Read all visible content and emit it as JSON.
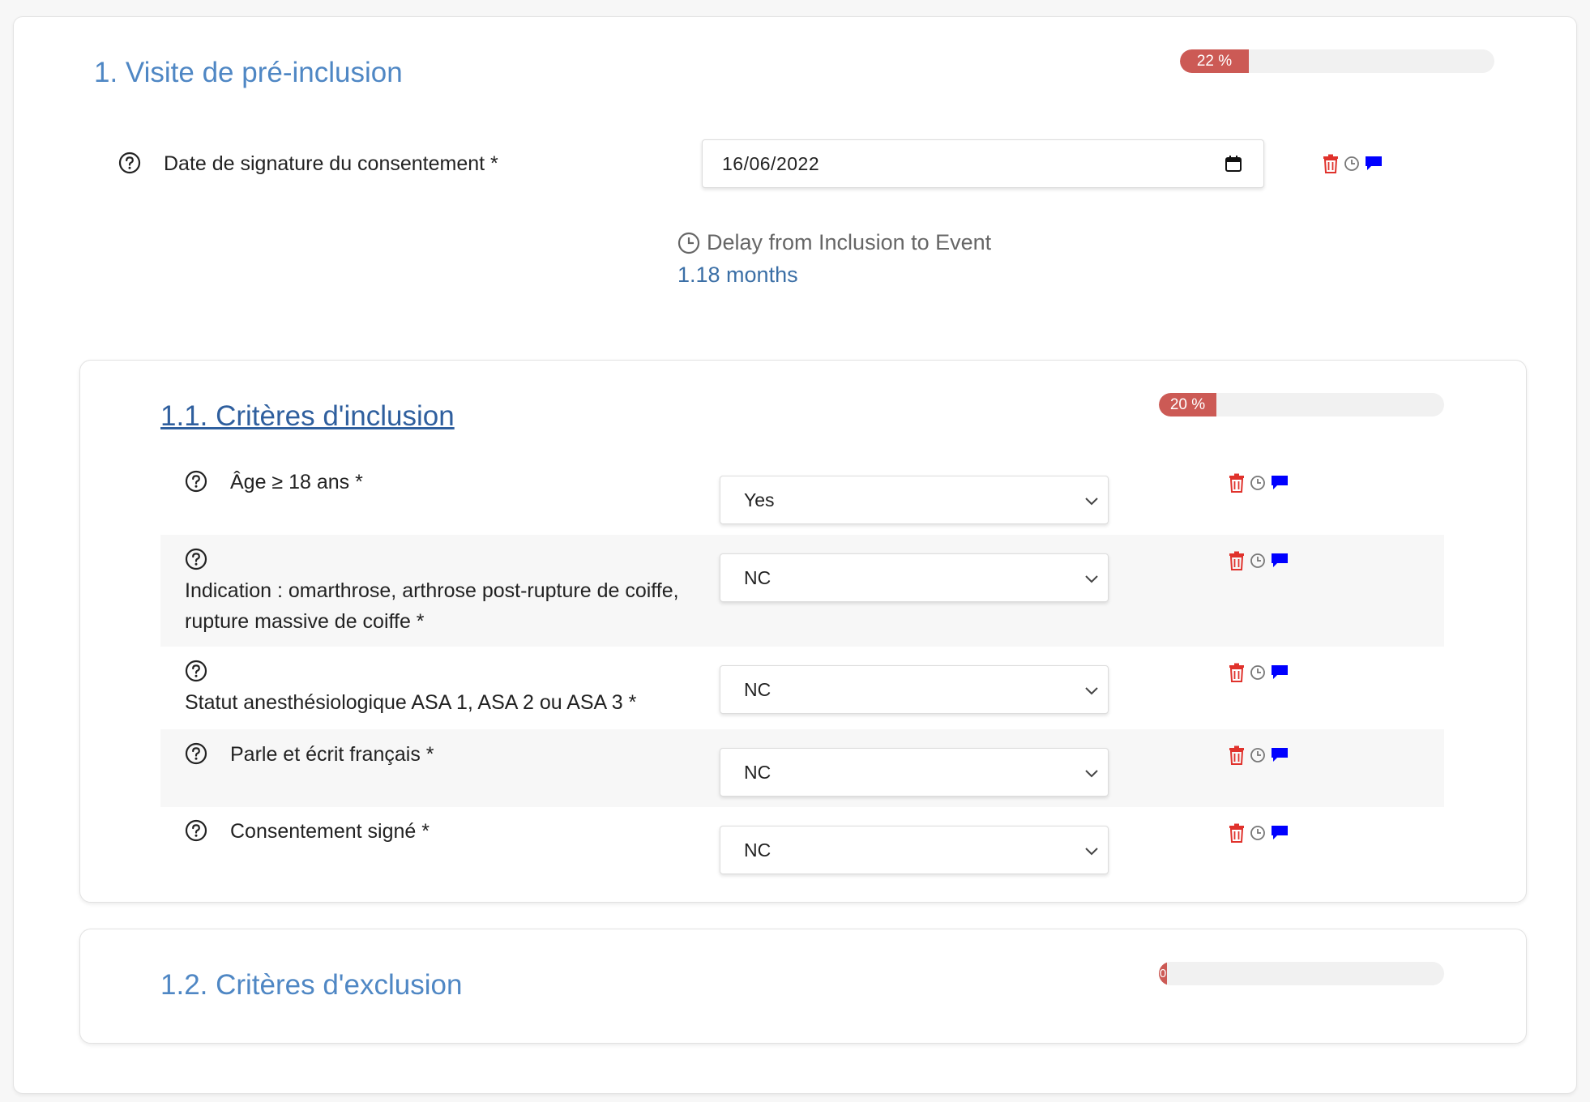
{
  "section1": {
    "title": "1. Visite de pré-inclusion",
    "progress_label": "22 %",
    "progress": 0.22
  },
  "consent_date": {
    "label": "Date de signature du consentement *",
    "value": "16/06/2022"
  },
  "delay": {
    "label": "Delay from Inclusion to Event",
    "value": "1.18 months"
  },
  "section1_1": {
    "title": "1.1. Critères d'inclusion",
    "progress_label": "20 %",
    "progress": 0.2,
    "rows": [
      {
        "label": "Âge ≥ 18 ans *",
        "value": "Yes"
      },
      {
        "label": "Indication : omarthrose, arthrose post-rupture de coiffe, rupture massive de coiffe *",
        "value": "NC"
      },
      {
        "label": "Statut anesthésiologique ASA 1, ASA 2 ou ASA 3 *",
        "value": "NC"
      },
      {
        "label": "Parle et écrit français *",
        "value": "NC"
      },
      {
        "label": "Consentement signé *",
        "value": "NC"
      }
    ]
  },
  "section1_2": {
    "title": "1.2. Critères d'exclusion",
    "progress_label": "0",
    "progress": 0.0
  },
  "icons": {
    "help": "question-circle-icon",
    "delete": "trash-icon",
    "history": "clock-icon",
    "comment": "comment-icon",
    "calendar": "calendar-icon",
    "dropdown": "chevron-down-icon"
  },
  "colors": {
    "section_title": "#4f87c4",
    "link_title": "#2f5f9e",
    "progress_fill": "#cc5a55",
    "delete_icon": "#e0322c",
    "comment_icon": "#0000ff",
    "delay_value": "#3b6fa6"
  }
}
